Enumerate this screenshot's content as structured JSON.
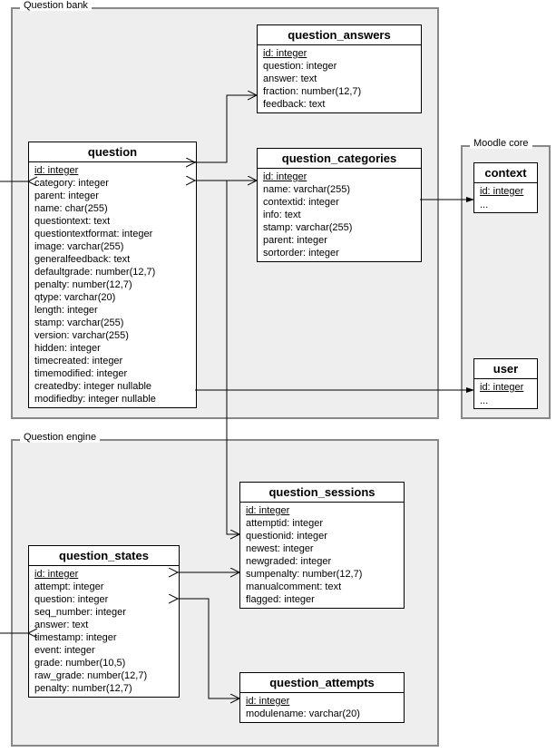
{
  "groups": {
    "question_bank": {
      "label": "Question bank"
    },
    "moodle_core": {
      "label": "Moodle core"
    },
    "question_engine": {
      "label": "Question engine"
    }
  },
  "entities": {
    "question": {
      "title": "question",
      "fields": [
        "id: integer",
        "category: integer",
        "parent: integer",
        "name: char(255)",
        "questiontext: text",
        "questiontextformat: integer",
        "image: varchar(255)",
        "generalfeedback: text",
        "defaultgrade: number(12,7)",
        "penalty: number(12,7)",
        "qtype: varchar(20)",
        "length: integer",
        "stamp: varchar(255)",
        "version: varchar(255)",
        "hidden: integer",
        "timecreated: integer",
        "timemodified: integer",
        "createdby: integer nullable",
        "modifiedby: integer nullable"
      ]
    },
    "question_answers": {
      "title": "question_answers",
      "fields": [
        "id: integer",
        "question: integer",
        "answer: text",
        "fraction: number(12,7)",
        "feedback: text"
      ]
    },
    "question_categories": {
      "title": "question_categories",
      "fields": [
        "id: integer",
        "name: varchar(255)",
        "contextid: integer",
        "info: text",
        "stamp: varchar(255)",
        "parent: integer",
        "sortorder: integer"
      ]
    },
    "context": {
      "title": "context",
      "fields": [
        "id: integer"
      ],
      "ellipsis": "..."
    },
    "user": {
      "title": "user",
      "fields": [
        "id: integer"
      ],
      "ellipsis": "..."
    },
    "question_sessions": {
      "title": "question_sessions",
      "fields": [
        "id: integer",
        "attemptid: integer",
        "questionid: integer",
        "newest: integer",
        "newgraded: integer",
        "sumpenalty: number(12,7)",
        "manualcomment: text",
        "flagged: integer"
      ]
    },
    "question_states": {
      "title": "question_states",
      "fields": [
        "id: integer",
        "attempt: integer",
        "question: integer",
        "seq_number: integer",
        "answer: text",
        "timestamp: integer",
        "event: integer",
        "grade: number(10,5)",
        "raw_grade: number(12,7)",
        "penalty: number(12,7)"
      ]
    },
    "question_attempts": {
      "title": "question_attempts",
      "fields": [
        "id: integer",
        "modulename: varchar(20)"
      ]
    }
  }
}
